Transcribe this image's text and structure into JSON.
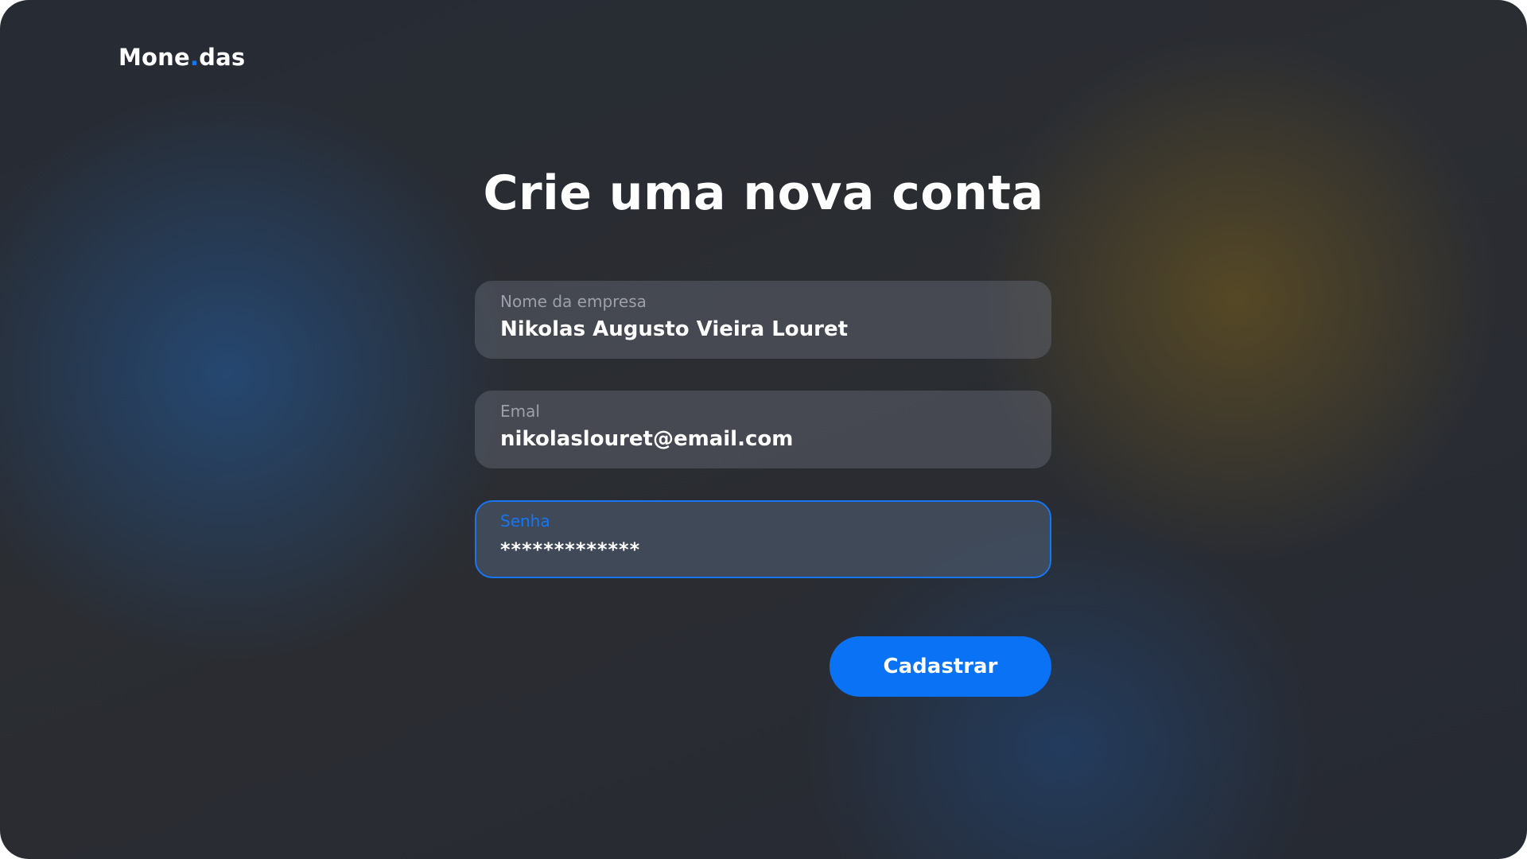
{
  "brand": {
    "name_part1": "Mone",
    "dot": ".",
    "name_part2": "das",
    "accent_color": "#1676f3"
  },
  "heading": "Crie uma nova conta",
  "form": {
    "company": {
      "label": "Nome da empresa",
      "value": "Nikolas Augusto Vieira Louret"
    },
    "email": {
      "label": "Emal",
      "value": "nikolaslouret@email.com"
    },
    "password": {
      "label": "Senha",
      "value": "*************",
      "focused": true
    }
  },
  "submit_button": {
    "label": "Cadastrar",
    "color": "#0a72f5"
  }
}
